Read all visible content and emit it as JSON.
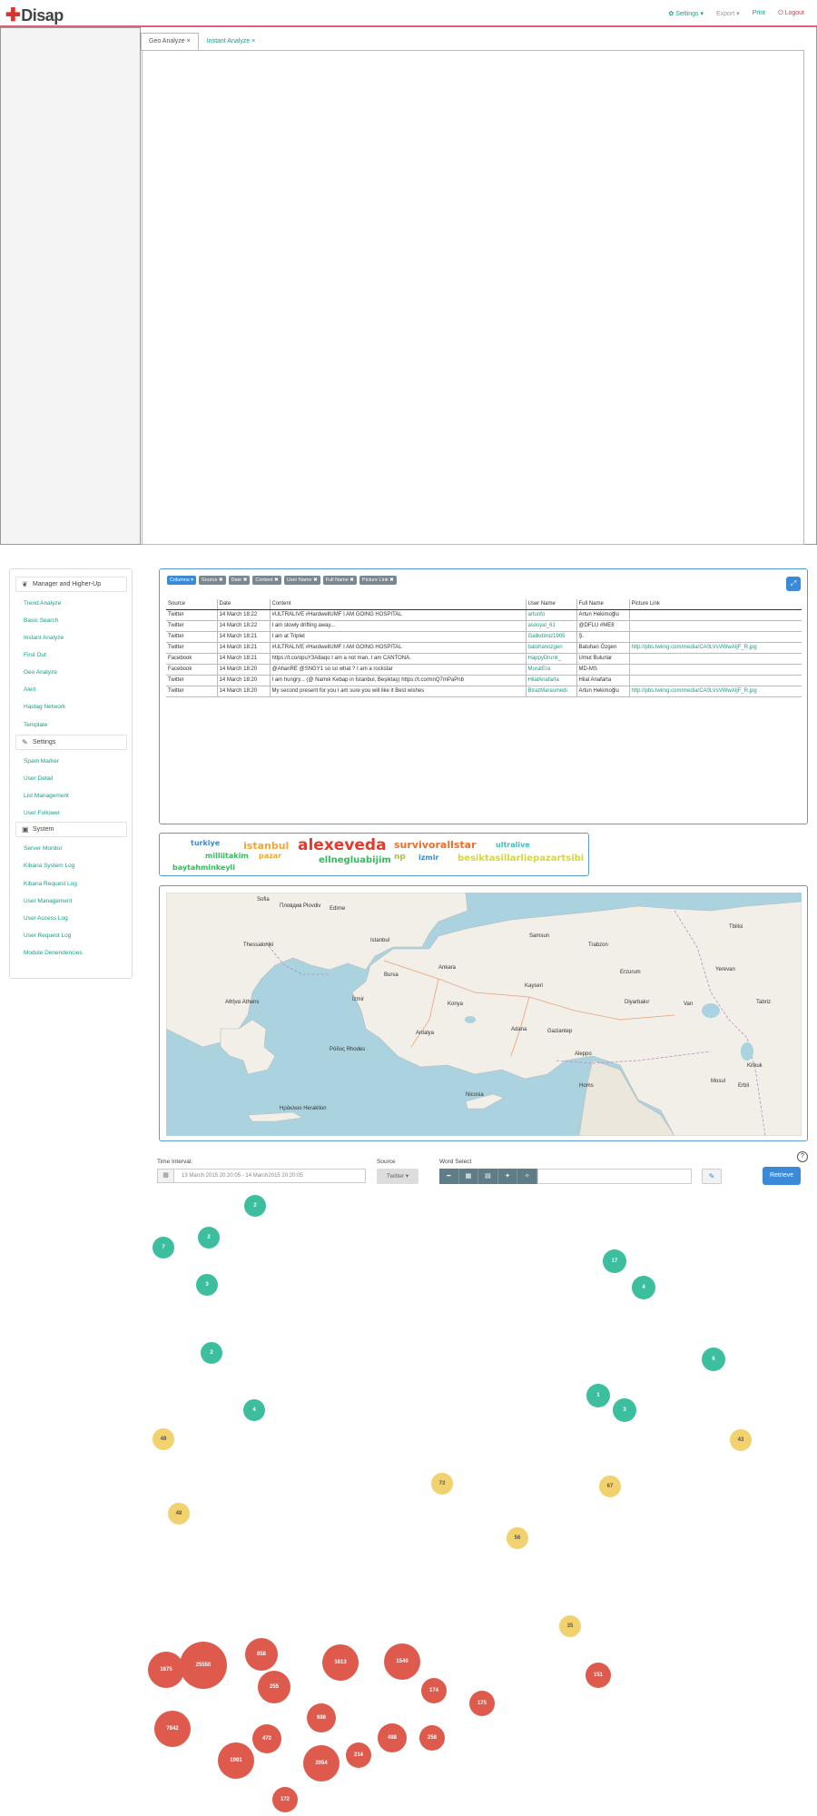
{
  "nav": {
    "logo": "Disap",
    "settings": "✿ Settings ▾",
    "export": "Export ▾",
    "print": "Print",
    "logout": "⏻ Logout"
  },
  "tabs": [
    {
      "label": "Geo Analyze ×"
    },
    {
      "label": "Instant Analyze ×"
    }
  ],
  "sidebar": {
    "sections": [
      {
        "label": "Manager and Higher-Up",
        "icon": "users-icon"
      },
      {
        "label": "Settings",
        "icon": "wrench-icon"
      },
      {
        "label": "System",
        "icon": "box-icon"
      }
    ],
    "items": [
      "Trend Analyze",
      "Basic Search",
      "Instant Analyze",
      "First Out",
      "Geo Analyze",
      "Alert",
      "Hastag Network",
      "Template",
      "Spam Marker",
      "User Detail",
      "List Management",
      "User Follower",
      "Server Monitor",
      "Kibana System Log",
      "Kibana Request Log",
      "User Management",
      "User Access Log",
      "User Request Log",
      "Module Denendencies"
    ]
  },
  "columns_tags": [
    "Columns ▾",
    "Source ✖",
    "Date ✖",
    "Content ✖",
    "User Name ✖",
    "Full Name ✖",
    "Picture Link ✖"
  ],
  "table": {
    "headers": [
      "Source",
      "Date",
      "Content",
      "User Name",
      "Full Name",
      "Picture Link"
    ],
    "rows": [
      [
        "Twitter",
        "14 March 18:22",
        "#ULTRALIVE #HardwellUMF I AM GOING HOSPITAL",
        "artunfo",
        "Artun Hekimoğlu",
        ""
      ],
      [
        "Twitter",
        "14 March 18:22",
        "I am slowly drifting away...",
        "asosyal_61",
        "@DFLU #ME8",
        ""
      ],
      [
        "Twitter",
        "14 March 18:21",
        "I am at Triplet",
        "Galikdimiz1905",
        "Ş.",
        ""
      ],
      [
        "Twitter",
        "14 March 18:21",
        "#ULTRALIVE #HardwellUMF I AM GOING HOSPITAL",
        "batuhanozgen",
        "Batuhan Özgen",
        "http://pbs.twimg.com/media/CA0LVsVWwAIjF_R.jpg"
      ],
      [
        "Facebook",
        "14 March 18:21",
        "https://t.co/opuY3A8aqo I am a not man, I am CANTONA.",
        "HappyDrunk_",
        "Umut Bulurlar",
        ""
      ],
      [
        "Facebook",
        "14 March 18:20",
        "@AhanRE @SNGY1 so so what ? I am a rockstar",
        "MuratEra",
        "MD-MS",
        ""
      ],
      [
        "Twitter",
        "14 March 18:20",
        "I am hungry... (@ Namık Kebap in İstanbul, Beşiktaş) https://t.co/mnQ7mPaPnb",
        "HilalAnafarta",
        "Hilal Anafarta",
        ""
      ],
      [
        "Twitter",
        "14 March 18:20",
        "My second present for you I am sure you will like it Best wishes",
        "BirazMarasmedi",
        "Artun Hekimoğlu",
        "http://pbs.twimg.com/media/CA0LVsVWwAIjF_R.jpg"
      ]
    ]
  },
  "wordcloud": [
    {
      "text": "turkiye",
      "color": "#3b8ad9"
    },
    {
      "text": "istanbul",
      "color": "#f0a830"
    },
    {
      "text": "alexeveda",
      "color": "#e8382b"
    },
    {
      "text": "survivorallstar",
      "color": "#e8702b"
    },
    {
      "text": "ultralive",
      "color": "#3dbfbf"
    },
    {
      "text": "milliitakim",
      "color": "#2fbf5a"
    },
    {
      "text": "pazar",
      "color": "#f0a830"
    },
    {
      "text": "ellnegluabijim",
      "color": "#2fbf5a"
    },
    {
      "text": "np",
      "color": "#a8c82b"
    },
    {
      "text": "izmir",
      "color": "#3b8ad9"
    },
    {
      "text": "besiktasillarliepazartsibi",
      "color": "#d8d82b"
    },
    {
      "text": "baytahminkeyli",
      "color": "#2fbf5a"
    }
  ],
  "map_labels": [
    "Sofia",
    "Пловдив Plovdiv",
    "Edirne",
    "Istanbul",
    "Bursa",
    "İzmir",
    "Ankara",
    "Konya",
    "Antalya",
    "Samsun",
    "Trabzon",
    "Kayseri",
    "Adana",
    "Gaziantep",
    "Erzurum",
    "Diyarbakır",
    "Van",
    "Tbilisi",
    "Yerevan",
    "Tabriz",
    "Mosul",
    "Aleppo",
    "Thessaloniki",
    "Αθήνα Athens",
    "Ηράκλειο Heraklion",
    "Ρόδος Rhodes",
    "Nicosia",
    "Homs",
    "Erbil",
    "Kirkuk"
  ],
  "controls": {
    "time_label": "Time Interval:",
    "time_value": "13 March 2015 20:20:05 - 14 March2015 20:20:05",
    "source_label": "Source",
    "source_value": "Twitter ▾",
    "word_label": "Word Select",
    "retrieve": "Retrieve",
    "help": "?"
  },
  "bubbles": {
    "green": [
      "2",
      "7",
      "2",
      "3",
      "4",
      "2",
      "17",
      "4",
      "6",
      "1",
      "3"
    ],
    "yellow": [
      "48",
      "43",
      "73",
      "67",
      "48",
      "56",
      "35"
    ],
    "red": [
      "1675",
      "25550",
      "858",
      "255",
      "1613",
      "1540",
      "151",
      "174",
      "175",
      "686",
      "7842",
      "472",
      "1991",
      "2054",
      "214",
      "488",
      "258",
      "172"
    ]
  },
  "colors": {
    "accent": "#1a9c86",
    "primary": "#3b8ad9",
    "danger": "#e0334b"
  }
}
